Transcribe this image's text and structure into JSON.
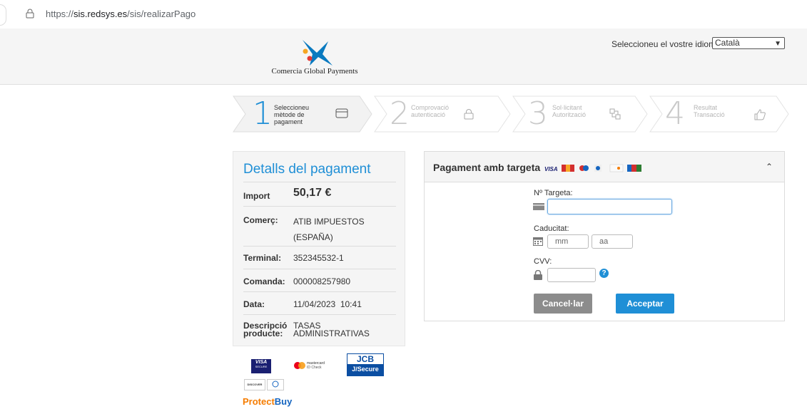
{
  "browser": {
    "url_prefix": "https://",
    "url_host": "sis.redsys.es",
    "url_path": "/sis/realizarPago"
  },
  "header": {
    "brand": "Comercia Global Payments",
    "language_label": "Seleccioneu el vostre idioma",
    "language_selected": "Català"
  },
  "steps": [
    {
      "number": "1",
      "label": "Seleccioneu mètode de pagament",
      "active": true,
      "icon": "card-icon"
    },
    {
      "number": "2",
      "label": "Comprovació autenticació",
      "active": false,
      "icon": "lock-icon"
    },
    {
      "number": "3",
      "label": "Sol·licitant Autorització",
      "active": false,
      "icon": "network-icon"
    },
    {
      "number": "4",
      "label": "Resultat Transacció",
      "active": false,
      "icon": "thumbs-up-icon"
    }
  ],
  "details": {
    "title": "Detalls del pagament",
    "rows": [
      {
        "key": "Import",
        "value": "50,17 €"
      },
      {
        "key": "Comerç:",
        "value": "ATIB IMPUESTOS (ESPAÑA)"
      },
      {
        "key": "Terminal:",
        "value": "352345532-1"
      },
      {
        "key": "Comanda:",
        "value": "000008257980"
      },
      {
        "key": "Data:",
        "value": "11/04/2023  10:41"
      },
      {
        "key": "Descripció producte:",
        "value": "TASAS ADMINISTRATIVAS"
      }
    ]
  },
  "payment": {
    "title": "Pagament amb targeta",
    "card_number_label": "Nº Targeta:",
    "expiry_label": "Caducitat:",
    "month_placeholder": "mm",
    "year_placeholder": "aa",
    "cvv_label": "CVV:",
    "help_icon": "?",
    "cancel_label": "Cancel·lar",
    "accept_label": "Acceptar"
  },
  "logos": {
    "visa_secure_top": "VISA",
    "visa_secure_bottom": "SECURE",
    "mastercard_top": "mastercard",
    "mastercard_bottom": "ID Check",
    "jcb_top": "JCB",
    "jcb_bottom": "J/Secure",
    "discover": "DISCOVER",
    "protectbuy_a": "Protect",
    "protectbuy_b": "Buy"
  },
  "colors": {
    "accent": "#1f8fd6",
    "cancel": "#8c8c8c"
  }
}
